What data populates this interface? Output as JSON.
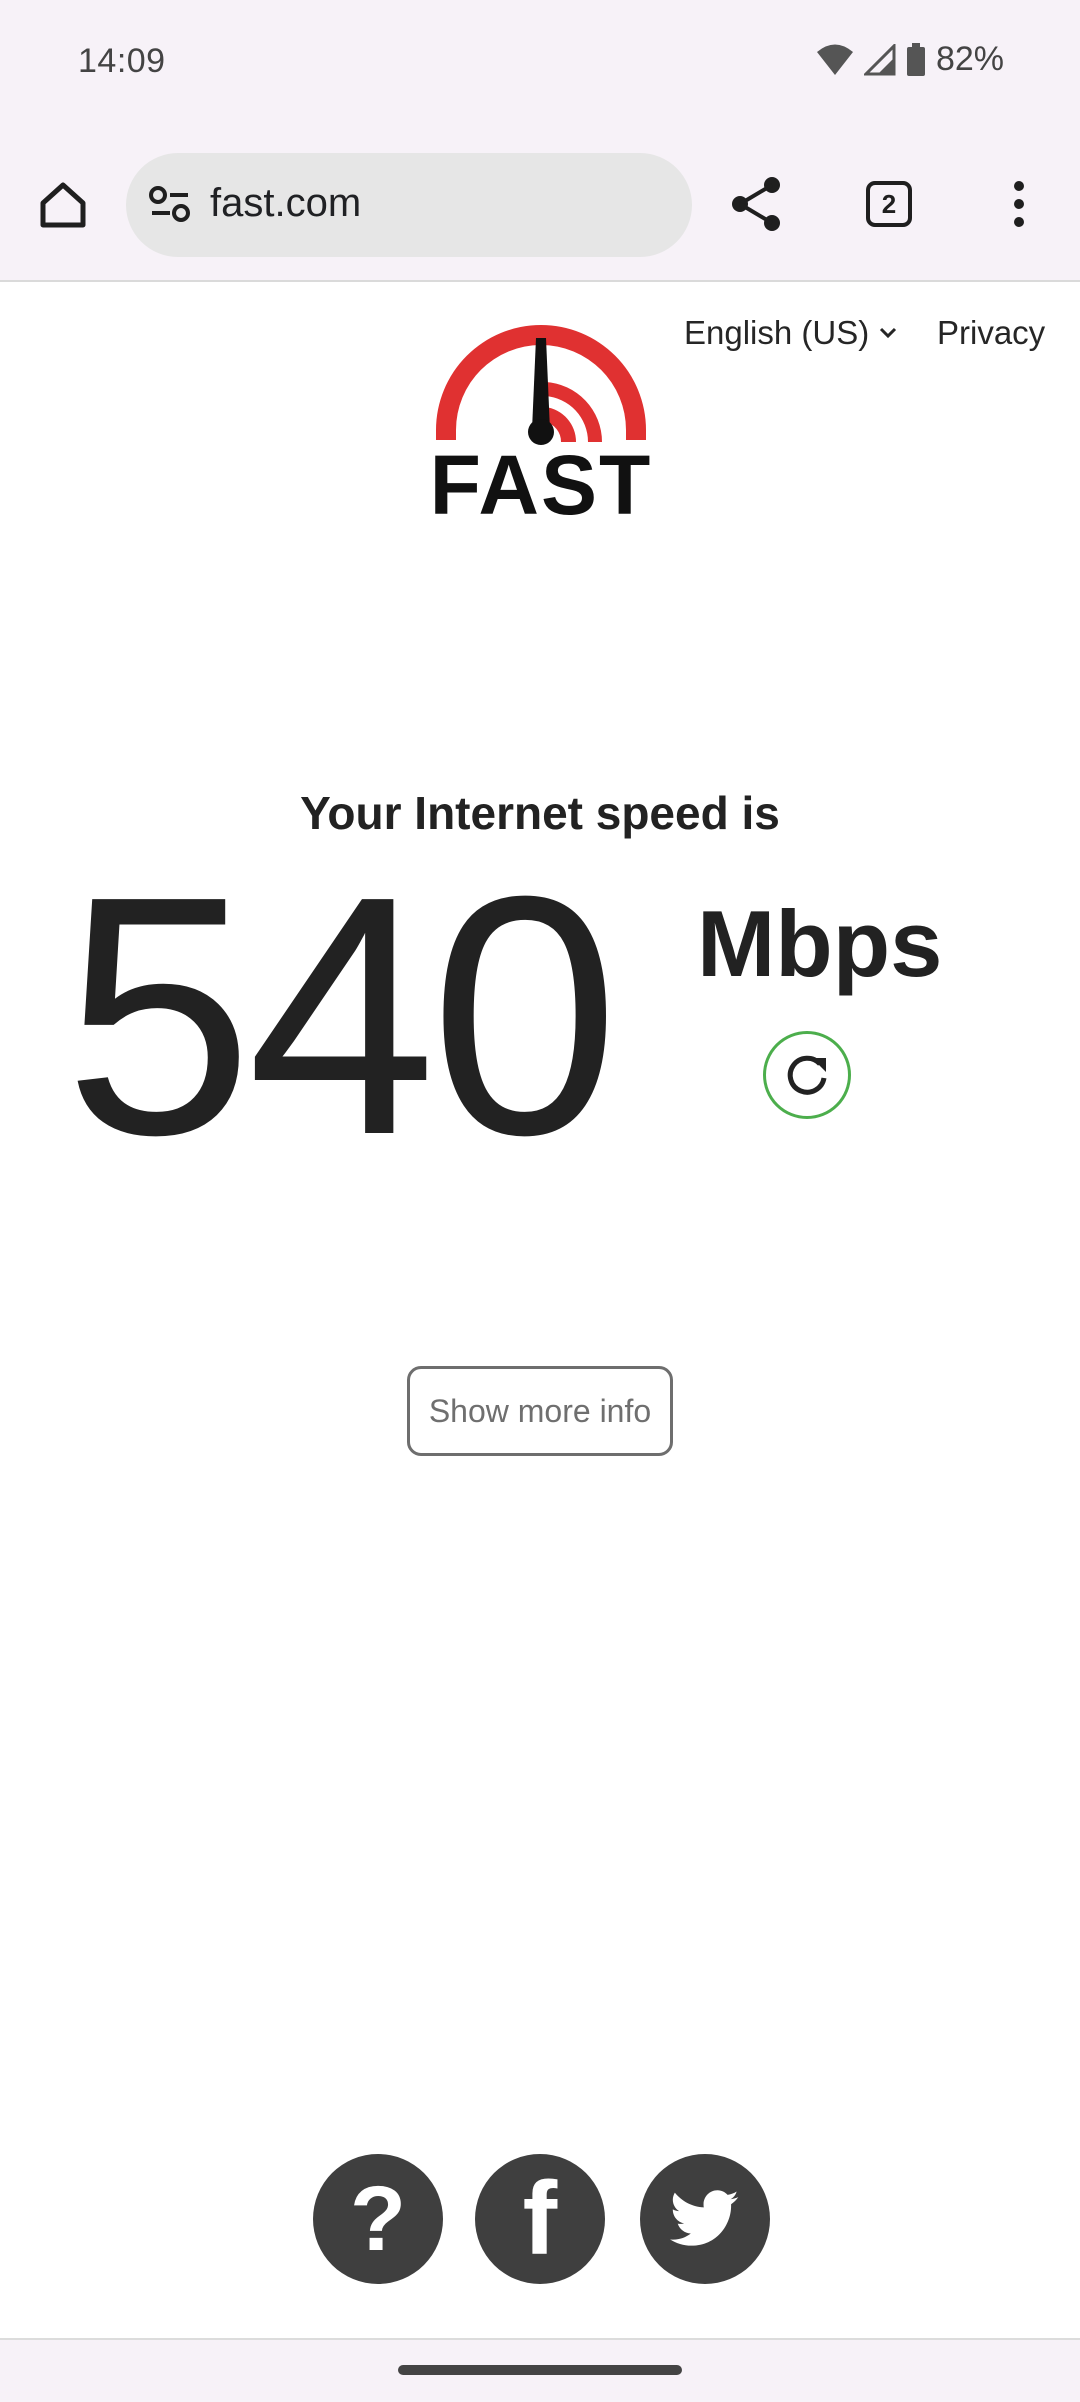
{
  "status_bar": {
    "time": "14:09",
    "battery_percent": "82%"
  },
  "browser": {
    "url": "fast.com",
    "tab_count": "2"
  },
  "header": {
    "language": "English (US)",
    "privacy_link": "Privacy",
    "logo_text": "FAST"
  },
  "speed": {
    "label": "Your Internet speed is",
    "value": "540",
    "units": "Mbps"
  },
  "more_info_button": "Show more info",
  "social": {
    "help": "?",
    "facebook": "f"
  },
  "colors": {
    "logo_red": "#e50914",
    "refresh_green": "#4cae4c",
    "social_bg": "#3f3f3f"
  }
}
